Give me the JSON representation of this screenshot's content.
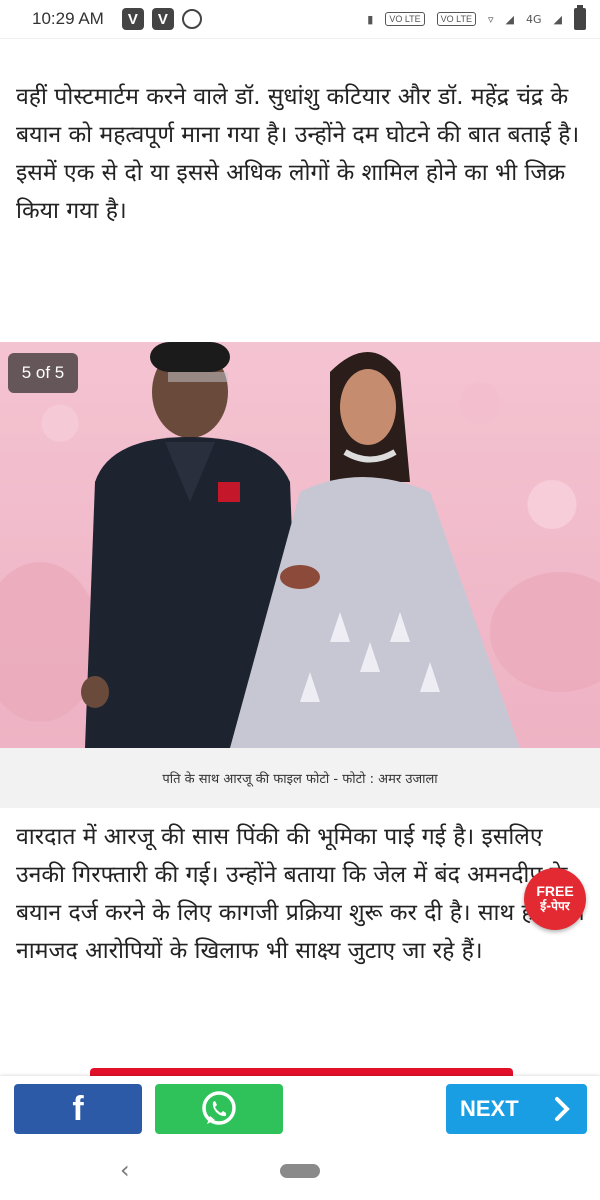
{
  "status_bar": {
    "time": "10:29 AM",
    "network_badge_1": "VO LTE",
    "network_badge_2": "VO LTE",
    "network_type": "4G"
  },
  "article": {
    "paragraph_1": "वहीं पोस्टमार्टम करने वाले डॉ. सुधांशु कटियार और डॉ. महेंद्र चंद्र के बयान को महत्वपूर्ण माना गया है। उन्होंने दम घोटने की बात बताई है। इसमें एक से दो या  इससे अधिक लोगों के शामिल होने का भी जिक्र किया गया है।",
    "photo_counter": "5 of 5",
    "photo_caption": "पति के साथ आरजू की फाइल फोटो  - फोटो : अमर उजाला",
    "paragraph_2": "वारदात में आरजू की सास पिंकी की भूमिका पाई गई है। इसलिए उनकी गिरफ्तारी की गई। उन्होंने बताया कि जेल में बंद अमनदीप के बयान दर्ज करने के लिए कागजी प्रक्रिया शुरू कर दी है। साथ ही अन्य नामजद आरोपियों के खिलाफ भी साक्ष्य जुटाए जा रहे हैं।"
  },
  "epaper_badge": {
    "free": "FREE",
    "label": "ई-पेपर"
  },
  "share_bar": {
    "facebook_icon": "facebook-icon",
    "whatsapp_icon": "whatsapp-icon",
    "next_label": "NEXT"
  },
  "colors": {
    "facebook": "#2d5aa6",
    "whatsapp": "#2fc25a",
    "next": "#1a9ee3",
    "accent_red": "#e3102a"
  }
}
